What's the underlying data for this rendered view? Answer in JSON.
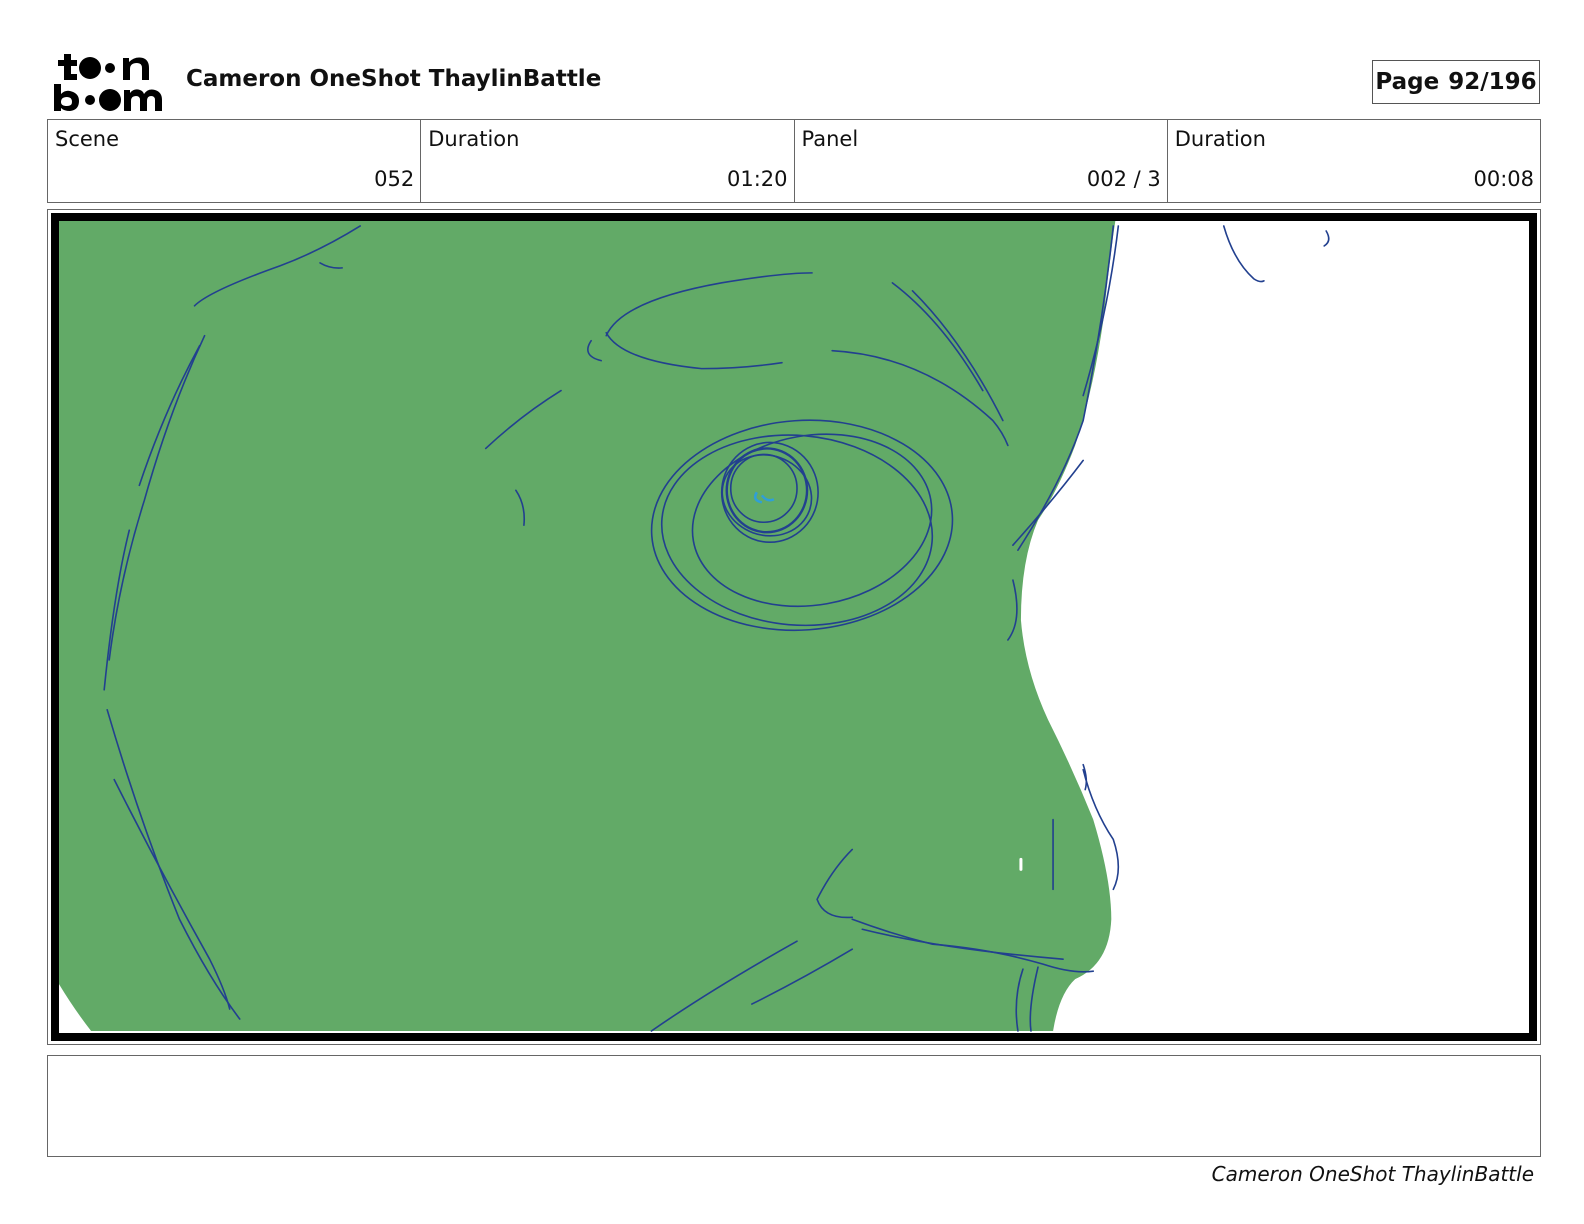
{
  "header": {
    "logo": {
      "top_line": "toon",
      "bottom_line": "boom"
    },
    "project_title": "Cameron OneShot ThaylinBattle",
    "page": {
      "label": "Page",
      "value": "92/196"
    }
  },
  "info": {
    "scene": {
      "label": "Scene",
      "value": "052"
    },
    "scene_duration": {
      "label": "Duration",
      "value": "01:20"
    },
    "panel": {
      "label": "Panel",
      "value": "002 / 3"
    },
    "panel_duration": {
      "label": "Duration",
      "value": "00:08"
    }
  },
  "panel_image": {
    "fill_color": "#62aa67",
    "line_color": "#22408f",
    "highlight_color": "#2f9fd8"
  },
  "notes": {
    "text": ""
  },
  "footer": {
    "title": "Cameron OneShot ThaylinBattle"
  }
}
